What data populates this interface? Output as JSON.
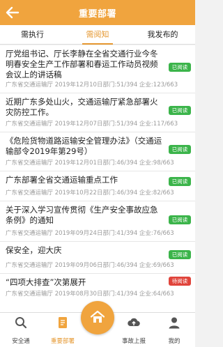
{
  "header": {
    "title": "重要部署"
  },
  "tabs": [
    "需执行",
    "需阅知",
    "我发布的"
  ],
  "items": [
    {
      "title": "厅党组书记、厅长李静在全省交通行业今冬明春安全生产工作部署和春运工作动员视频会议上的讲话稿",
      "meta": "广东省交通运输厅   2019年12月10日部门:51/394   企业:123/663",
      "status": "已阅读",
      "status_type": "read"
    },
    {
      "title": "近期广东多处山火，交通运输厅紧急部署火灾防控工作。",
      "meta": "广东省交通运输厅   2019年12月07日部门:51/394   企业:117/663",
      "status": "已阅读",
      "status_type": "read"
    },
    {
      "title": "《危险货物道路运输安全管理办法》（交通运输部令2019年第29号）",
      "meta": "广东省交通运输厅   2019年12月01日部门:46/394   企业:98/663",
      "status": "已阅读",
      "status_type": "read"
    },
    {
      "title": "广东部署全省交通运输重点工作",
      "meta": "广东省交通运输厅   2019年10月22日部门:46/394   企业:82/663",
      "status": "已阅读",
      "status_type": "read"
    },
    {
      "title": "关于深入学习宣传贯彻《生产安全事故应急条例》的通知",
      "meta": "广东省交通运输厅   2019年09月24日部门:41/394   企业:76/663",
      "status": "已阅读",
      "status_type": "read"
    },
    {
      "title": "保安全，迎大庆",
      "meta": "广东省交通运输厅   2019年09月06日部门:46/394   企业:69/663",
      "status": "已阅读",
      "status_type": "read"
    },
    {
      "title": "“四项大排查”次第展开",
      "meta": "广东省交通运输厅   2019年08月30日部门:41/394   企业:64/663",
      "status": "待阅读",
      "status_type": "unread"
    }
  ],
  "bottom_nav": [
    {
      "label": "安全通",
      "icon": "search-icon",
      "active": false
    },
    {
      "label": "重要部署",
      "icon": "document-icon",
      "active": true
    },
    {
      "label": "首页",
      "icon": "home-icon",
      "active": false
    },
    {
      "label": "事故上报",
      "icon": "upload-cloud-icon",
      "active": false
    },
    {
      "label": "我的",
      "icon": "user-icon",
      "active": false
    }
  ],
  "colors": {
    "primary": "#f0a43e",
    "accent_text": "#e5972f",
    "read_badge": "#3bb44a",
    "unread_badge": "#e0443b"
  }
}
